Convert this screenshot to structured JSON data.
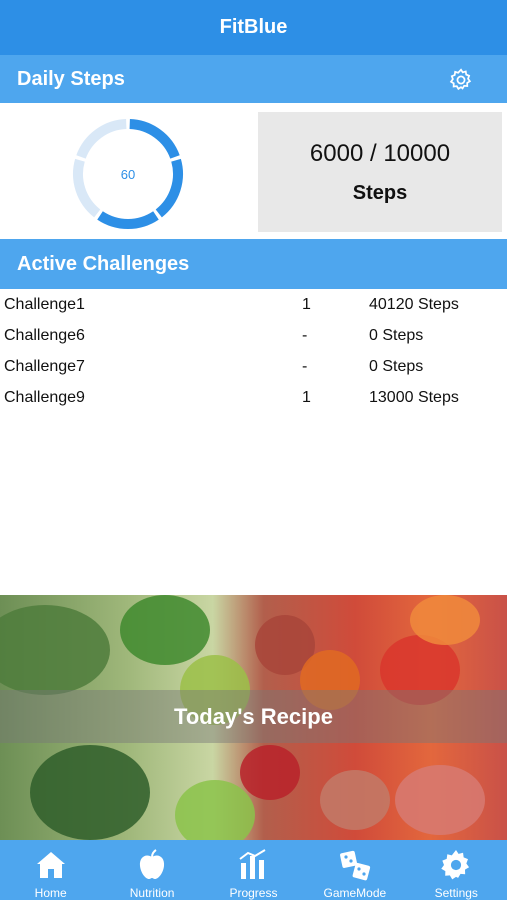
{
  "header": {
    "title": "FitBlue"
  },
  "daily_steps": {
    "title": "Daily Steps",
    "progress_percent_label": "60",
    "progress_fraction": 0.6,
    "current_over_goal": "6000 / 10000",
    "unit": "Steps"
  },
  "challenges": {
    "title": "Active Challenges",
    "rows": [
      {
        "name": "Challenge1",
        "rank": "1",
        "steps": "40120 Steps"
      },
      {
        "name": "Challenge6",
        "rank": "-",
        "steps": "0 Steps"
      },
      {
        "name": "Challenge7",
        "rank": "-",
        "steps": "0 Steps"
      },
      {
        "name": "Challenge9",
        "rank": "1",
        "steps": "13000 Steps"
      }
    ]
  },
  "recipe": {
    "label": "Today's Recipe"
  },
  "tabs": [
    {
      "label": "Home",
      "icon": "home-icon"
    },
    {
      "label": "Nutrition",
      "icon": "apple-icon"
    },
    {
      "label": "Progress",
      "icon": "bar-chart-icon"
    },
    {
      "label": "GameMode",
      "icon": "dice-icon"
    },
    {
      "label": "Settings",
      "icon": "gear-icon"
    }
  ],
  "colors": {
    "primary": "#2d8fe6",
    "section": "#4ea6ee",
    "ring_track": "#d9e8f7"
  }
}
